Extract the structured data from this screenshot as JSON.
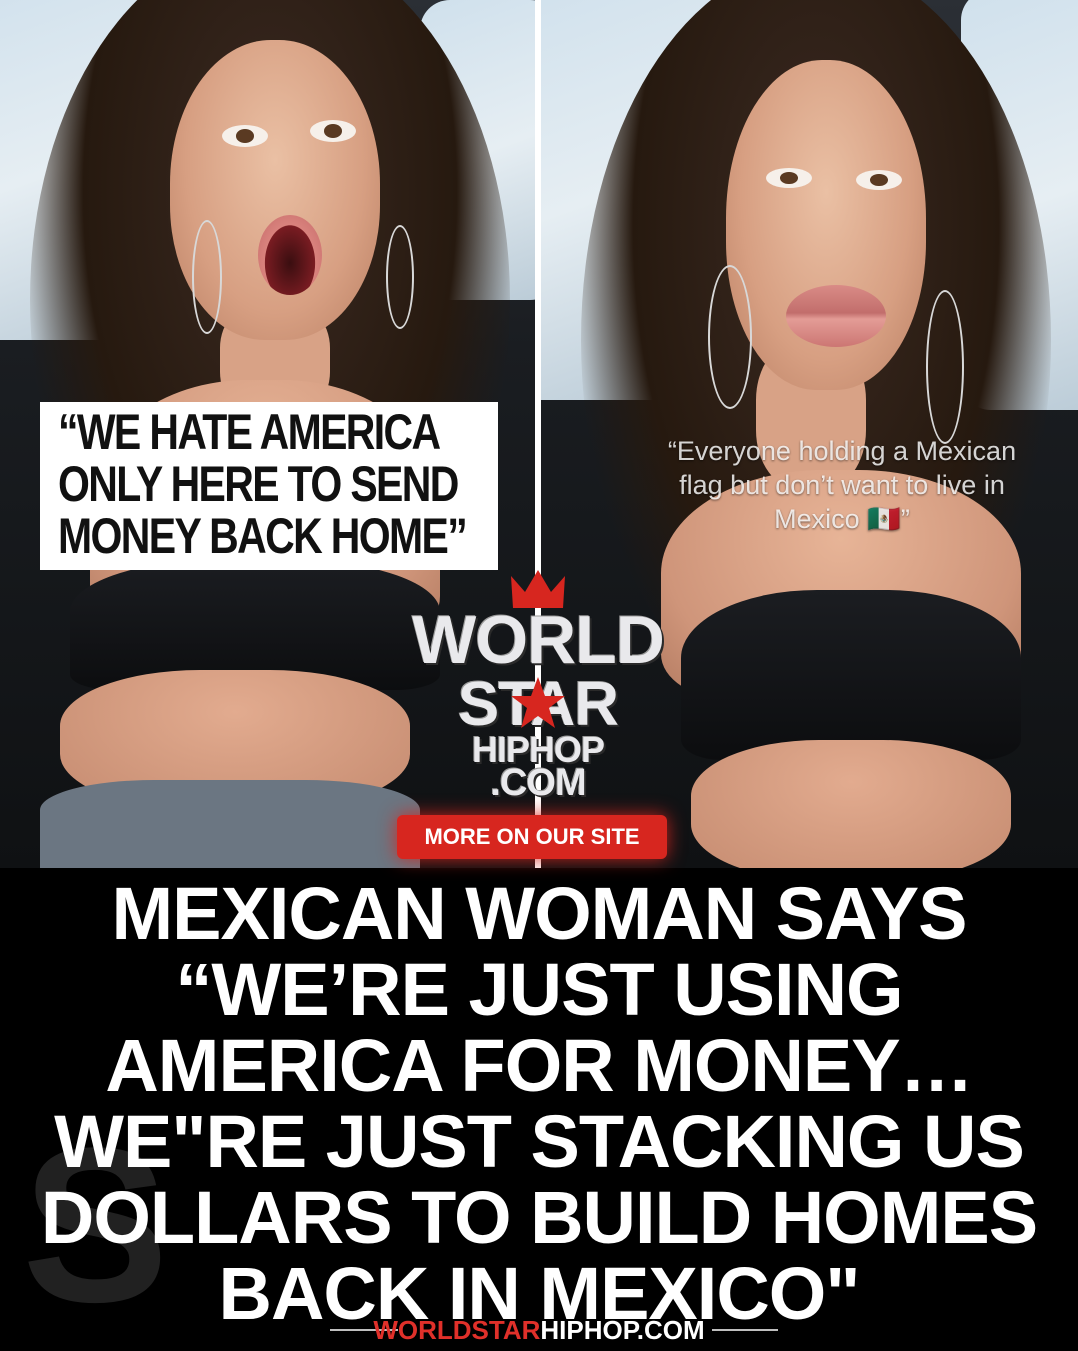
{
  "left_overlay": {
    "lines": [
      "“WE HATE AMERICA",
      "ONLY HERE TO SEND",
      "MONEY BACK HOME”"
    ]
  },
  "right_caption": {
    "lines": [
      "“Everyone holding a Mexican",
      "flag but don’t want to live in",
      "Mexico 🇲🇽”"
    ]
  },
  "logo": {
    "lines": [
      "WORLD",
      "STAR",
      "HIPHOP",
      ".COM"
    ]
  },
  "site_badge": "MORE ON OUR SITE",
  "headline": {
    "lines": [
      "MEXICAN WOMAN SAYS",
      "“WE’RE JUST USING",
      "AMERICA FOR MONEY…",
      "WE\"RE JUST STACKING US",
      "DOLLARS TO BUILD HOMES",
      "BACK IN MEXICO\""
    ]
  },
  "footer": {
    "brand_red": "WORLDSTAR",
    "brand_white": "HIPHOP.COM"
  },
  "colors": {
    "accent_red": "#d7261f",
    "background": "#000000",
    "headline": "#ffffff"
  }
}
